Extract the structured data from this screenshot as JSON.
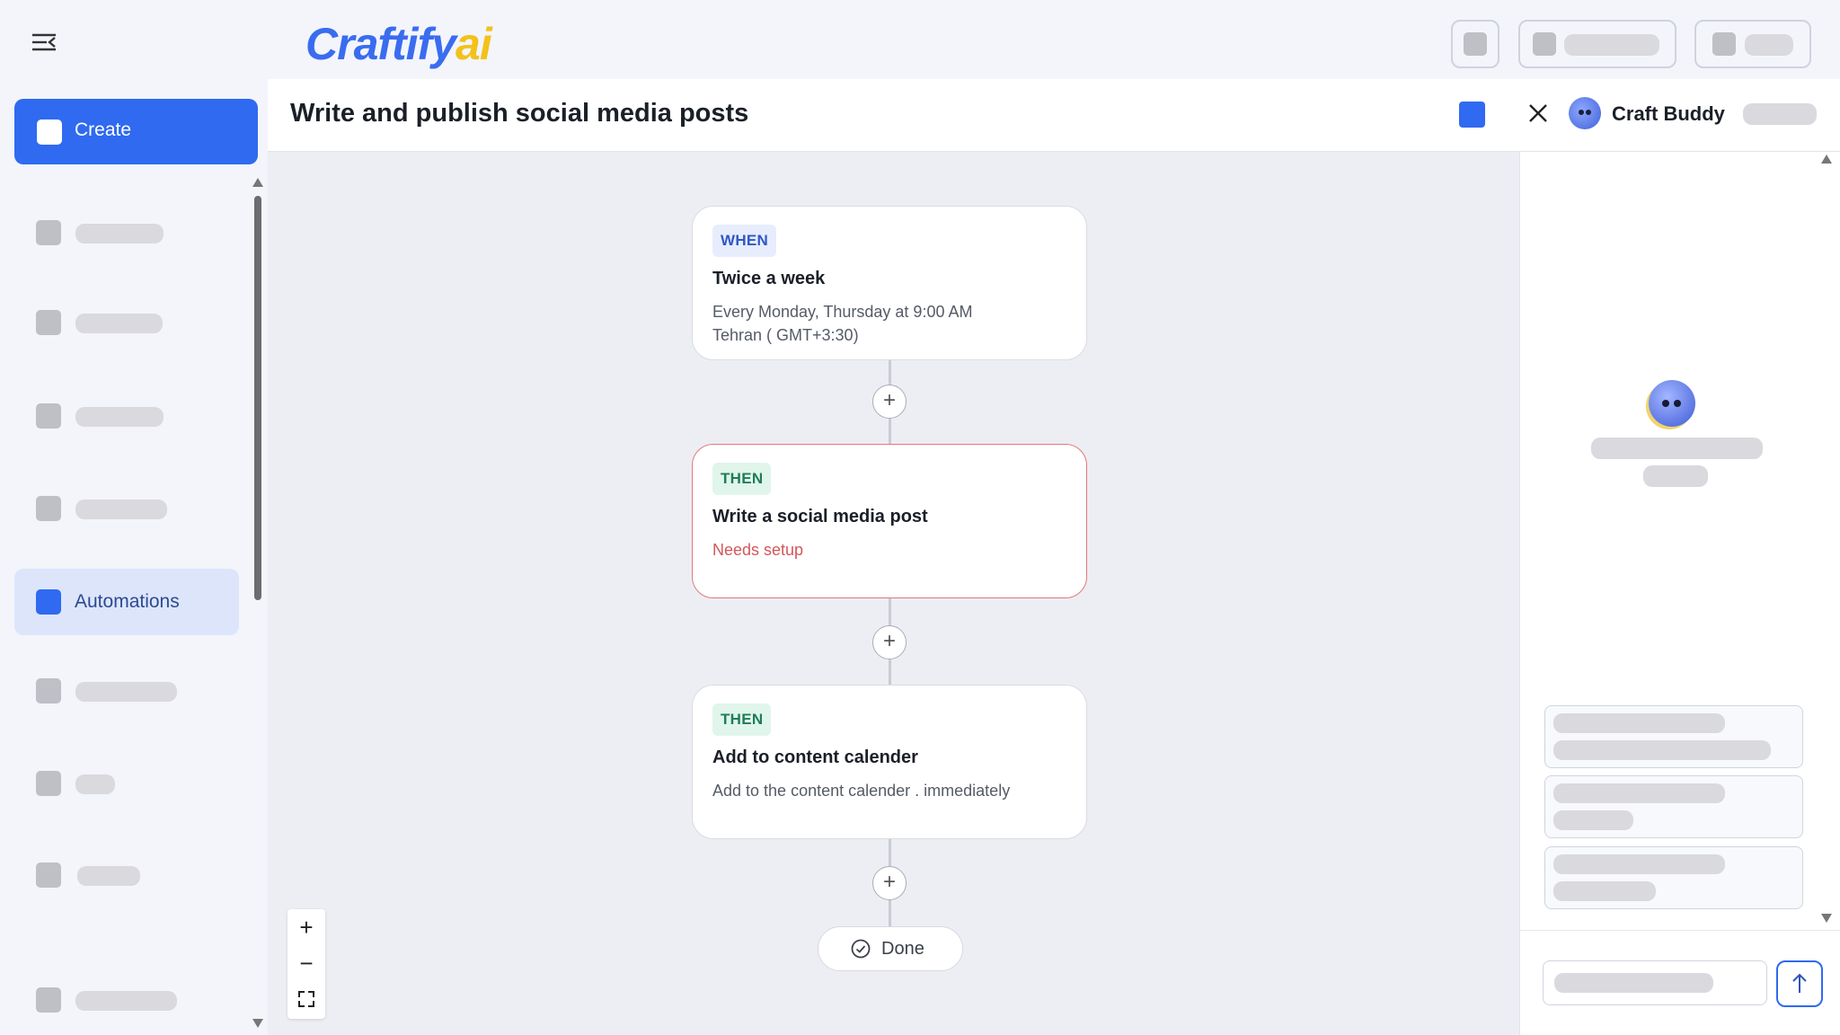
{
  "app": {
    "logo_main": "Craftify",
    "logo_ai": "ai"
  },
  "sidebar": {
    "create_label": "Create",
    "active_item_label": "Automations"
  },
  "header": {
    "title": "Write and publish social media posts",
    "assistant_name": "Craft Buddy"
  },
  "workflow": {
    "trigger": {
      "tag": "WHEN",
      "title": "Twice a week",
      "line1": "Every Monday, Thursday at 9:00 AM",
      "line2": "Tehran ( GMT+3:30)"
    },
    "step1": {
      "tag": "THEN",
      "title": "Write a social media post",
      "status": "Needs setup"
    },
    "step2": {
      "tag": "THEN",
      "title": "Add to content calender",
      "detail": "Add to the content calender . immediately"
    },
    "add_step_symbol": "+",
    "done_label": "Done"
  },
  "zoom": {
    "in": "+",
    "out": "−"
  },
  "colors": {
    "accent": "#2f6af0",
    "error": "#d2575a",
    "logo_ai": "#f2c21b"
  }
}
